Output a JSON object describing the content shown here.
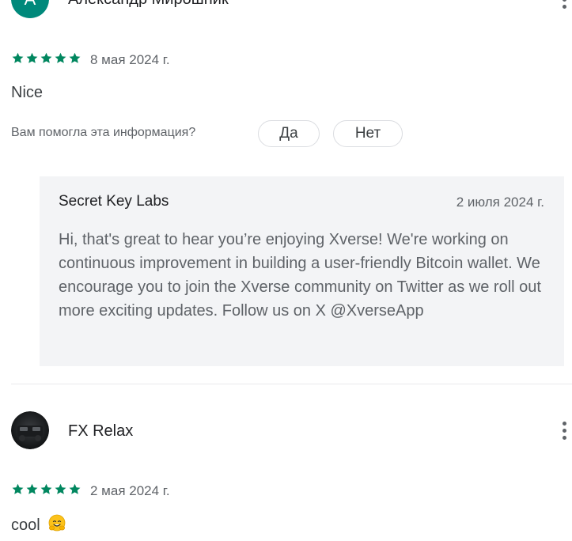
{
  "reviews": [
    {
      "author_initial": "А",
      "author_name": "Александр Мирошник",
      "rating": 5,
      "date": "8 мая 2024 г.",
      "text": "Nice",
      "helpful_question": "Вам помогла эта информация?",
      "yes_label": "Да",
      "no_label": "Нет",
      "developer_reply": {
        "name": "Secret Key Labs",
        "date": "2 июля 2024 г.",
        "text": "Hi, that's great to hear you’re enjoying Xverse! We're working on continuous improvement in building a user-friendly Bitcoin wallet. We encourage you to join the Xverse community on Twitter as we roll out more exciting updates. Follow us on X @XverseApp"
      }
    },
    {
      "author_name": "FX Relax",
      "rating": 5,
      "date": "2 мая 2024 г.",
      "text": "cool"
    }
  ],
  "colors": {
    "star": "#01875f",
    "avatar_bg": "#00897b",
    "reply_bg": "#f3f4f6"
  },
  "icons": {
    "menu": "more-vert-icon",
    "star": "star-icon",
    "emoji": "hugging-face-emoji"
  }
}
